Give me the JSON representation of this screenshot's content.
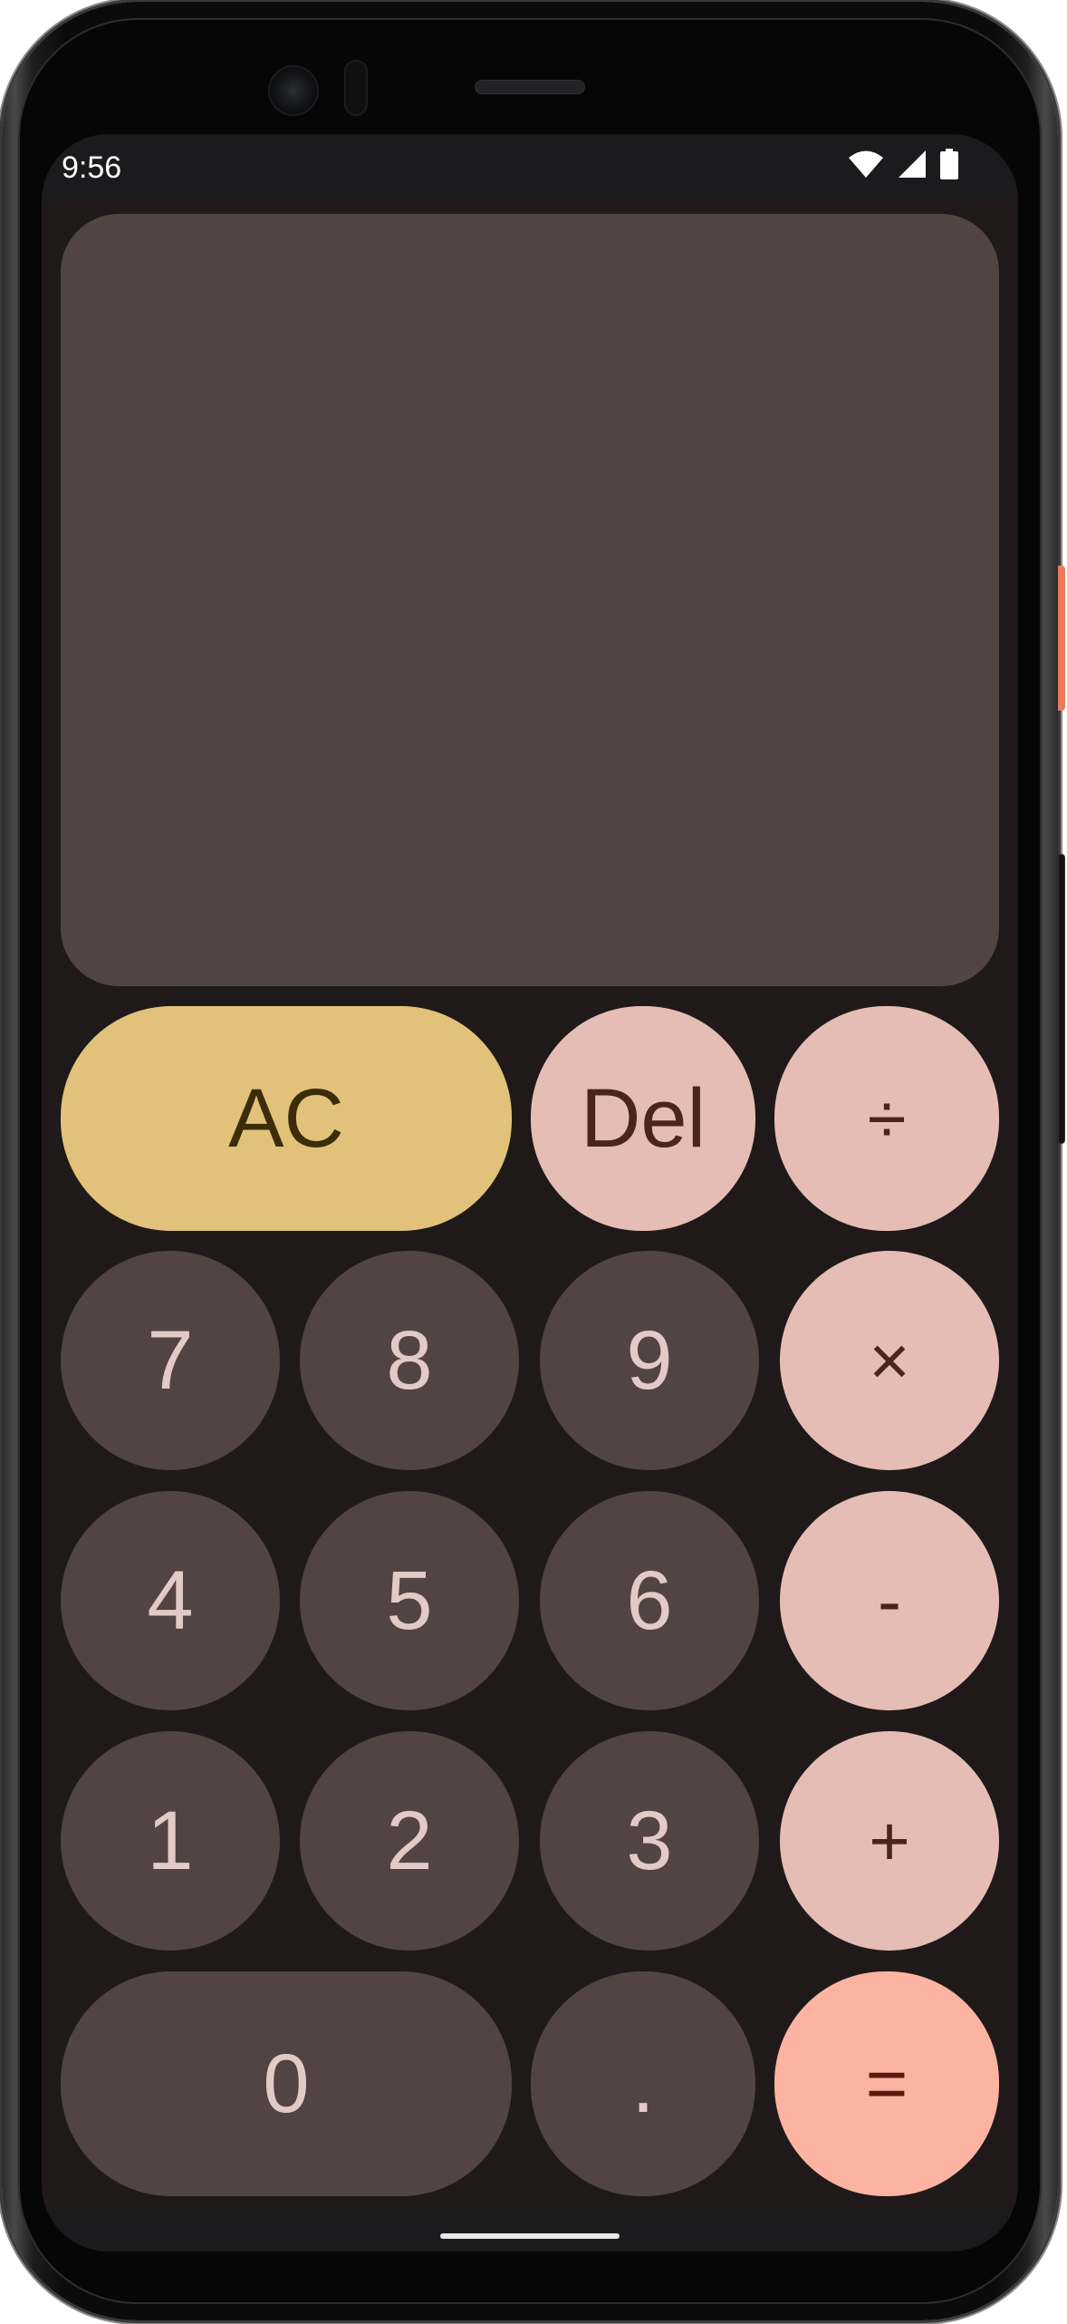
{
  "status_bar": {
    "time": "9:56",
    "icons": [
      "wifi-icon",
      "cell-signal-icon",
      "battery-icon"
    ]
  },
  "display": {
    "expression": "",
    "result": ""
  },
  "keypad": {
    "clear": "AC",
    "delete": "Del",
    "divide": "÷",
    "multiply": "×",
    "subtract": "-",
    "add": "+",
    "equals": "=",
    "decimal": ".",
    "digits": {
      "zero": "0",
      "one": "1",
      "two": "2",
      "three": "3",
      "four": "4",
      "five": "5",
      "six": "6",
      "seven": "7",
      "eight": "8",
      "nine": "9"
    }
  },
  "colors": {
    "screen_background": "#1f1a19",
    "display_panel": "#514442",
    "number_key": "#514442",
    "operator_key": "#e6bdb5",
    "clear_key": "#e2c27a",
    "equals_key": "#fdb3a2"
  }
}
